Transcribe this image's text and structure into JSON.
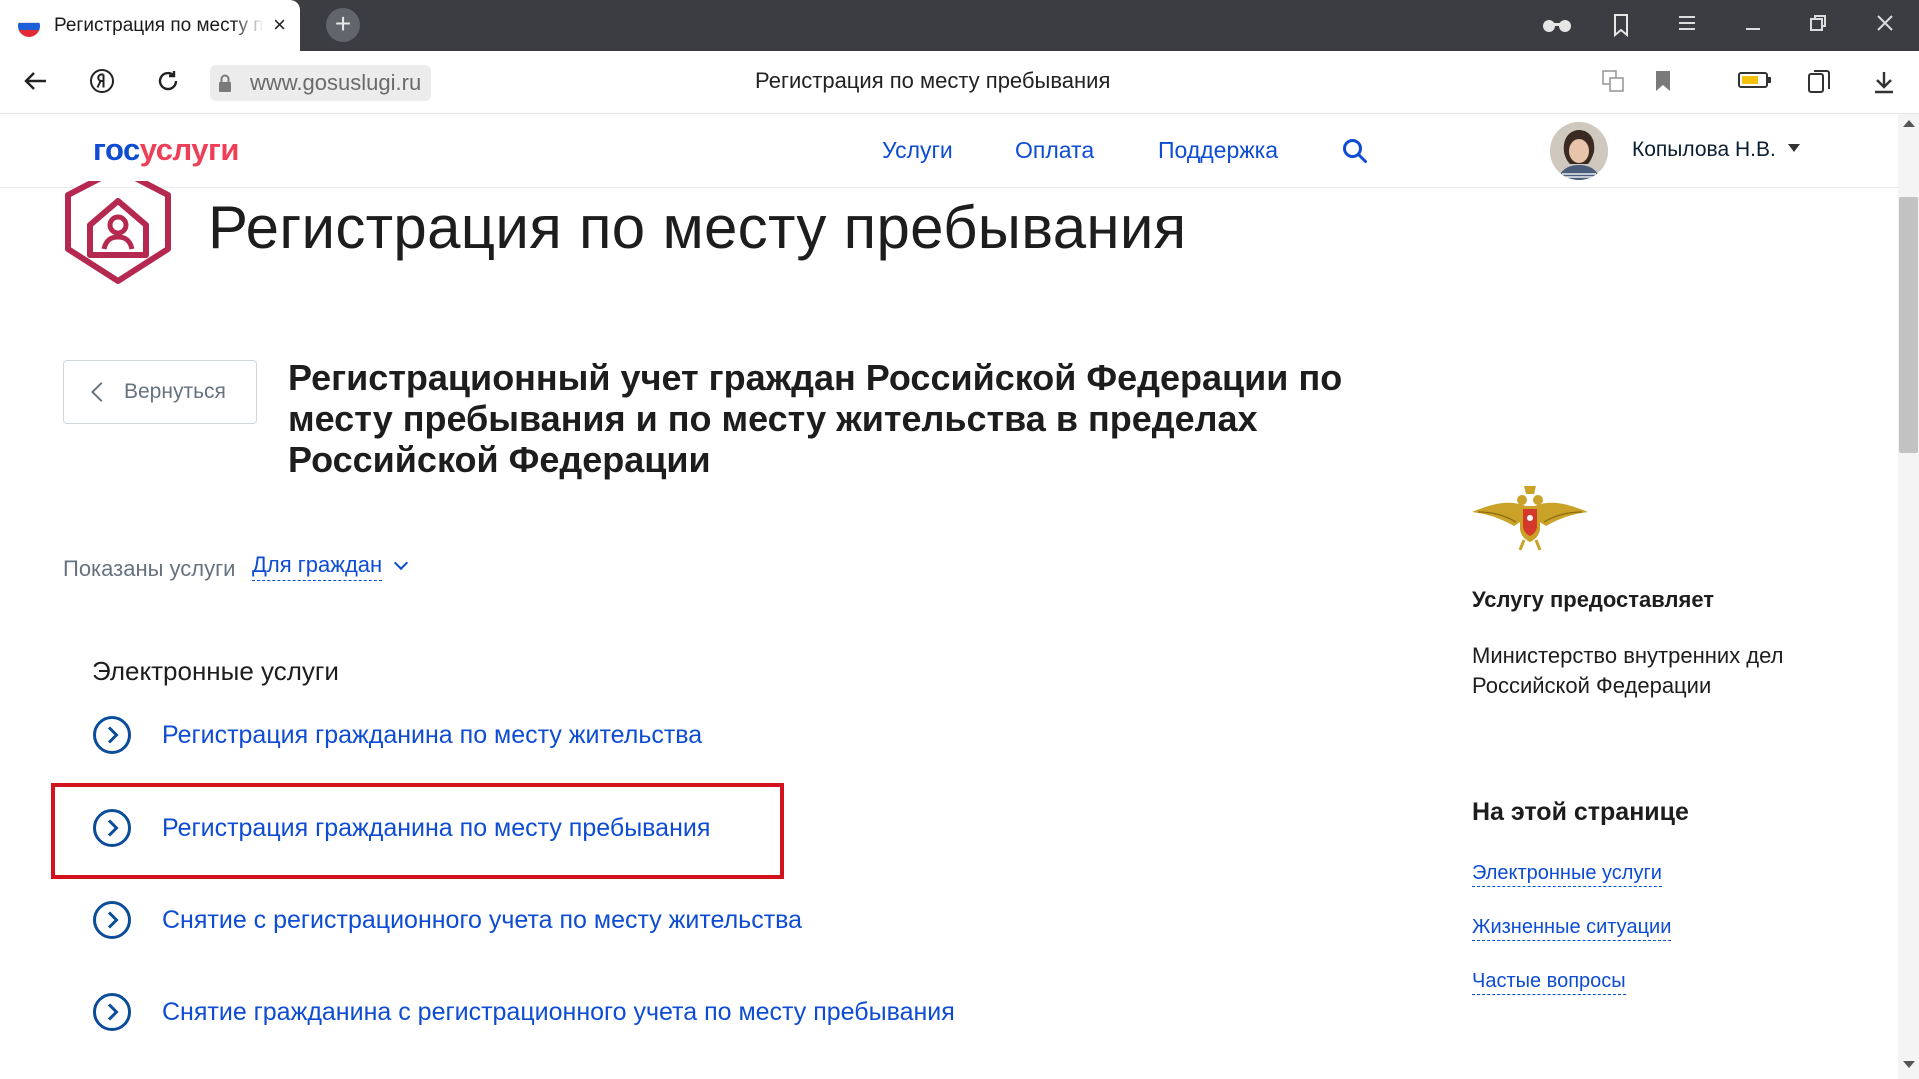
{
  "browser": {
    "tab_title": "Регистрация по месту пребывания",
    "tab_close": "×",
    "new_tab": "+",
    "url": "www.gosuslugi.ru",
    "page_title": "Регистрация по месту пребывания"
  },
  "header": {
    "logo_part1": "гос",
    "logo_part2": "услуги",
    "menu": [
      "Услуги",
      "Оплата",
      "Поддержка"
    ],
    "user_name": "Копылова Н.В."
  },
  "page": {
    "title": "Регистрация по месту пребывания",
    "back_label": "Вернуться",
    "subtitle": "Регистрационный учет граждан Российской Федерации по месту пребывания и по месту жительства в пределах Российской Федерации",
    "filter_label": "Показаны услуги",
    "filter_value": "Для граждан",
    "section_title": "Электронные услуги",
    "services": [
      "Регистрация гражданина по месту жительства",
      "Регистрация гражданина по месту пребывания",
      "Снятие с регистрационного учета по месту жительства",
      "Снятие гражданина с регистрационного учета по месту пребывания"
    ]
  },
  "sidebar": {
    "provider_title": "Услугу предоставляет",
    "provider_name": "Министерство внутренних дел Российской Федерации",
    "toc_title": "На этой странице",
    "toc_links": [
      "Электронные услуги",
      "Жизненные ситуации",
      "Частые вопросы"
    ]
  },
  "colors": {
    "link_blue": "#0d4cd3",
    "logo_red": "#ee3f58",
    "emblem_crimson": "#b5284f",
    "highlight_red": "#d2121d"
  }
}
